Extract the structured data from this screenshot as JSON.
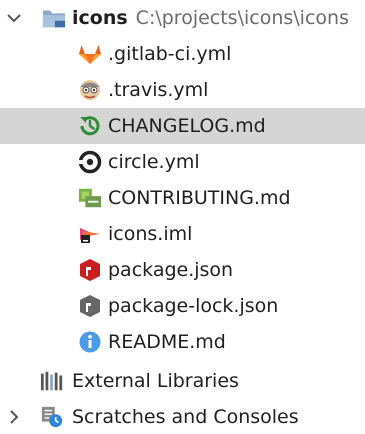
{
  "tree": {
    "root": {
      "name": "icons",
      "path": "C:\\projects\\icons\\icons",
      "expanded": true
    },
    "files": [
      {
        "label": ".gitlab-ci.yml",
        "icon": "gitlab-icon"
      },
      {
        "label": ".travis.yml",
        "icon": "travis-icon"
      },
      {
        "label": "CHANGELOG.md",
        "icon": "changelog-icon",
        "selected": true
      },
      {
        "label": "circle.yml",
        "icon": "circleci-icon"
      },
      {
        "label": "CONTRIBUTING.md",
        "icon": "contributing-icon"
      },
      {
        "label": "icons.iml",
        "icon": "iml-module-icon"
      },
      {
        "label": "package.json",
        "icon": "npm-icon"
      },
      {
        "label": "package-lock.json",
        "icon": "npm-lock-icon"
      },
      {
        "label": "README.md",
        "icon": "readme-info-icon"
      }
    ],
    "external_libraries": {
      "label": "External Libraries",
      "icon": "libraries-icon"
    },
    "scratches": {
      "label": "Scratches and Consoles",
      "icon": "scratches-icon",
      "expanded": false
    }
  },
  "colors": {
    "selection": "#d5d5d5",
    "path_text": "#6b6b6b",
    "changelog_green": "#2e8b3a",
    "npm_red": "#cb1d1d",
    "npm_lock_gray": "#666666",
    "info_blue": "#4a9be8",
    "gitlab_orange": "#e2622a"
  }
}
